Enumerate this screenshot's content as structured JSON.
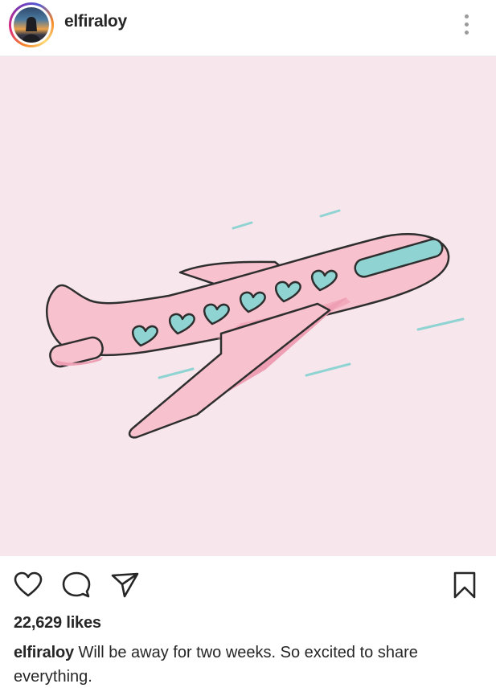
{
  "post": {
    "username": "elfiraloy",
    "likes_count": "22,629",
    "likes_word": "likes",
    "caption_user": "elfiraloy",
    "caption_text": "Will be away for two weeks. So excited to share everything."
  },
  "icons": {
    "more": "more-options-icon",
    "like": "heart-icon",
    "comment": "comment-icon",
    "share": "send-icon",
    "save": "bookmark-icon"
  },
  "colors": {
    "image_background": "#f7e6ec",
    "plane_body": "#f8c1ce",
    "plane_shadow": "#ef9fb4",
    "hearts_and_window": "#8fd3d3",
    "outline": "#2e2e2e"
  },
  "image": {
    "subject": "pink airplane with heart-shaped windows"
  }
}
